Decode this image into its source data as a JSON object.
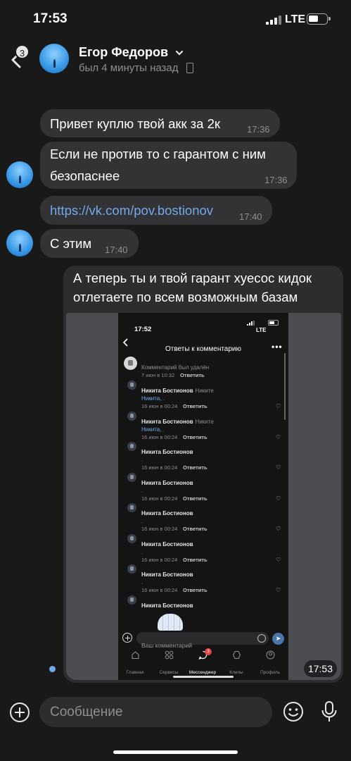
{
  "status_bar": {
    "time": "17:53",
    "network": "LTE"
  },
  "header": {
    "back_badge": "3",
    "contact_name": "Егор Федоров",
    "contact_status": "был 4 минуты назад"
  },
  "messages": [
    {
      "text": "Привет куплю твой акк за 2к",
      "time": "17:36",
      "direction": "incoming"
    },
    {
      "text": "Если не против то с гарантом с ним безопаснее",
      "time": "17:36",
      "direction": "incoming"
    },
    {
      "text": "https://vk.com/pov.bostionov",
      "time": "17:40",
      "direction": "incoming",
      "is_link": true
    },
    {
      "text": "С этим",
      "time": "17:40",
      "direction": "incoming"
    },
    {
      "text": "А теперь ты и твой гарант хуесос кидок отлетаете по всем возможным базам",
      "time": "17:53",
      "direction": "outgoing"
    }
  ],
  "attached_screenshot": {
    "status_time": "17:52",
    "status_network": "LTE",
    "title": "Ответы к комментарию",
    "deleted_comment": {
      "text": "Комментарий был удалён",
      "date": "7 июн в 10:32",
      "reply_label": "Ответить"
    },
    "comments": [
      {
        "author": "Никита Бостионов",
        "reply_to": "Никите",
        "mention": "Никита,",
        "tail": ".",
        "date": "16 июн в 00:24",
        "reply_label": "Ответить"
      },
      {
        "author": "Никита Бостионов",
        "reply_to": "Никите",
        "mention": "Никита,",
        "tail": ".",
        "date": "16 июн в 00:24",
        "reply_label": "Ответить"
      },
      {
        "author": "Никита Бостионов",
        "reply_to": "",
        "mention": "",
        "tail": ".",
        "date": "16 июн в 00:24",
        "reply_label": "Ответить"
      },
      {
        "author": "Никита Бостионов",
        "reply_to": "",
        "mention": "",
        "tail": ".",
        "date": "16 июн в 00:24",
        "reply_label": "Ответить"
      },
      {
        "author": "Никита Бостионов",
        "reply_to": "",
        "mention": "",
        "tail": ".",
        "date": "16 июн в 00:24",
        "reply_label": "Ответить"
      },
      {
        "author": "Никита Бостионов",
        "reply_to": "",
        "mention": "",
        "tail": ".",
        "date": "16 июн в 00:24",
        "reply_label": "Ответить"
      },
      {
        "author": "Никита Бостионов",
        "reply_to": "",
        "mention": "",
        "tail": ".",
        "date": "16 июн в 00:24",
        "reply_label": "Ответить"
      },
      {
        "author": "Никита Бостионов",
        "reply_to": "",
        "mention": "",
        "tail": "",
        "date": "",
        "reply_label": ""
      }
    ],
    "input_placeholder": "Ваш комментарий",
    "tabs": [
      {
        "label": "Главная",
        "icon": "home-icon"
      },
      {
        "label": "Сервисы",
        "icon": "grid-icon"
      },
      {
        "label": "Мессенджер",
        "icon": "chat-icon",
        "badge": "3",
        "active": true
      },
      {
        "label": "Клипы",
        "icon": "clips-icon"
      },
      {
        "label": "Профиль",
        "icon": "profile-icon"
      }
    ]
  },
  "composer": {
    "placeholder": "Сообщение"
  },
  "colors": {
    "background": "#191919",
    "bubble": "#333335",
    "link": "#71aaeb",
    "muted": "#8e8e93"
  }
}
